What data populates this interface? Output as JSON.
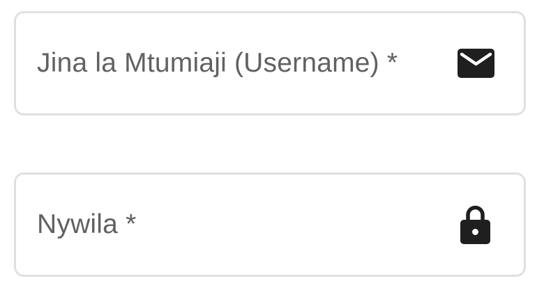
{
  "form": {
    "username": {
      "label": "Jina la Mtumiaji (Username) *",
      "value": "",
      "icon": "mail-icon"
    },
    "password": {
      "label": "Nywila *",
      "value": "",
      "icon": "lock-icon"
    }
  },
  "colors": {
    "border": "#e0e0e0",
    "label": "#616161",
    "icon": "#1f1f1f"
  }
}
